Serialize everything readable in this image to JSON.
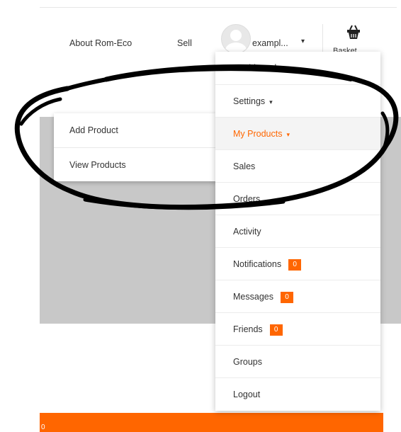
{
  "nav": {
    "about": "About Rom-Eco",
    "sell": "Sell",
    "user": "exampl...",
    "user_caret": "▾",
    "basket_label": "Basket"
  },
  "dropdown": {
    "items": [
      {
        "label": "Dashboard",
        "caret": "",
        "badge": ""
      },
      {
        "label": "Settings",
        "caret": "▾",
        "badge": ""
      },
      {
        "label": "My Products",
        "caret": "▾",
        "badge": ""
      },
      {
        "label": "Sales",
        "caret": "",
        "badge": ""
      },
      {
        "label": "Orders",
        "caret": "",
        "badge": ""
      },
      {
        "label": "Activity",
        "caret": "",
        "badge": ""
      },
      {
        "label": "Notifications",
        "caret": "",
        "badge": "0"
      },
      {
        "label": "Messages",
        "caret": "",
        "badge": "0"
      },
      {
        "label": "Friends",
        "caret": "",
        "badge": "0"
      },
      {
        "label": "Groups",
        "caret": "",
        "badge": ""
      },
      {
        "label": "Logout",
        "caret": "",
        "badge": ""
      }
    ]
  },
  "submenu": {
    "items": [
      {
        "label": "Add Product"
      },
      {
        "label": "View Products"
      }
    ]
  },
  "footer_bar": {
    "text": "0"
  },
  "colors": {
    "accent": "#ff6600",
    "panel": "#c8c8c8",
    "annotation_stroke": "#000000"
  },
  "icons": {
    "avatar": "avatar-placeholder-icon",
    "basket": "basket-icon"
  }
}
